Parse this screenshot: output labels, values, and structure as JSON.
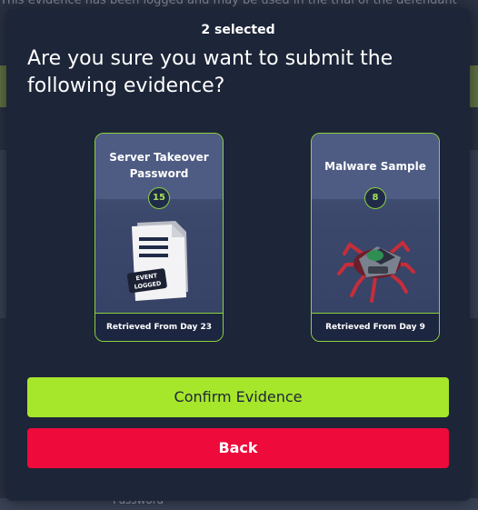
{
  "background": {
    "top_text": "This evidence has been logged and may be used in the trial of the defendant",
    "bottom_label": "Password"
  },
  "modal": {
    "selected_count": "2 selected",
    "question": "Are you sure you want to submit the following evidence?",
    "cards": [
      {
        "title": "Server Takeover Password",
        "count": "15",
        "image_icon": "document-event-logged-icon",
        "image_text_line1": "EVENT",
        "image_text_line2": "LOGGED",
        "footer": "Retrieved From Day 23"
      },
      {
        "title": "Malware Sample",
        "count": "8",
        "image_icon": "malware-spider-icon",
        "footer": "Retrieved From Day 9"
      }
    ],
    "confirm_label": "Confirm Evidence",
    "back_label": "Back"
  },
  "colors": {
    "modal_bg": "#1d2538",
    "accent_green": "#a6e62b",
    "card_border": "#8bd13c",
    "danger_red": "#ee0a3b"
  }
}
